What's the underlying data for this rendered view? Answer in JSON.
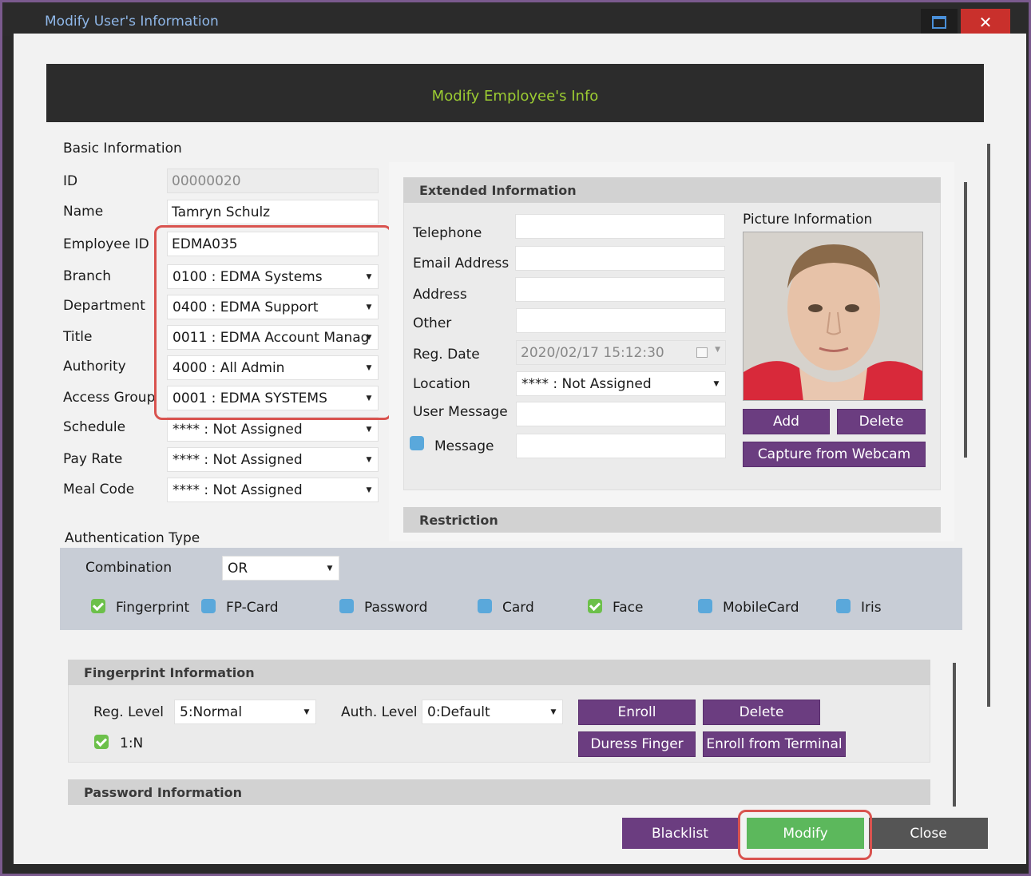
{
  "window": {
    "title": "Modify User's Information",
    "maximize_icon": "maximize-icon",
    "close_icon": "close-icon",
    "close_glyph": "✕"
  },
  "header": {
    "title": "Modify Employee's Info"
  },
  "basic": {
    "heading": "Basic Information",
    "id_label": "ID",
    "id_value": "00000020",
    "name_label": "Name",
    "name_value": "Tamryn Schulz",
    "employee_id_label": "Employee ID",
    "employee_id_value": "EDMA035",
    "branch_label": "Branch",
    "branch_value": "0100 : EDMA Systems",
    "department_label": "Department",
    "department_value": "0400 : EDMA Support",
    "title_label": "Title",
    "title_value": "0011 : EDMA Account Manag",
    "authority_label": "Authority",
    "authority_value": "4000 : All Admin",
    "access_group_label": "Access Group",
    "access_group_value": "0001 : EDMA SYSTEMS",
    "schedule_label": "Schedule",
    "schedule_value": "**** : Not Assigned",
    "pay_rate_label": "Pay Rate",
    "pay_rate_value": "**** : Not Assigned",
    "meal_code_label": "Meal Code",
    "meal_code_value": "**** : Not Assigned"
  },
  "extended": {
    "heading": "Extended Information",
    "telephone_label": "Telephone",
    "telephone_value": "",
    "email_label": "Email Address",
    "email_value": "",
    "address_label": "Address",
    "address_value": "",
    "other_label": "Other",
    "other_value": "",
    "reg_date_label": "Reg. Date",
    "reg_date_value": "2020/02/17 15:12:30",
    "location_label": "Location",
    "location_value": "**** : Not Assigned",
    "user_message_label": "User Message",
    "user_message_value": "",
    "message_label": "Message",
    "message_value": "",
    "picture_label": "Picture Information",
    "add_label": "Add",
    "delete_label": "Delete",
    "webcam_label": "Capture from Webcam"
  },
  "restriction": {
    "heading": "Restriction"
  },
  "auth": {
    "heading": "Authentication Type",
    "combination_label": "Combination",
    "combination_value": "OR",
    "options": [
      {
        "label": "Fingerprint",
        "checked": true
      },
      {
        "label": "FP-Card",
        "checked": false
      },
      {
        "label": "Password",
        "checked": false
      },
      {
        "label": "Card",
        "checked": false
      },
      {
        "label": "Face",
        "checked": true
      },
      {
        "label": "MobileCard",
        "checked": false
      },
      {
        "label": "Iris",
        "checked": false
      }
    ]
  },
  "fingerprint": {
    "heading": "Fingerprint Information",
    "reg_level_label": "Reg. Level",
    "reg_level_value": "5:Normal",
    "auth_level_label": "Auth. Level",
    "auth_level_value": "0:Default",
    "one_n_label": "1:N",
    "one_n_checked": true,
    "enroll_label": "Enroll",
    "delete_label": "Delete",
    "duress_label": "Duress Finger",
    "enroll_terminal_label": "Enroll from Terminal"
  },
  "password": {
    "heading": "Password Information"
  },
  "footer": {
    "blacklist_label": "Blacklist",
    "modify_label": "Modify",
    "close_label": "Close"
  },
  "colors": {
    "accent_purple": "#6b3d80",
    "modify_green": "#5cb85c",
    "highlight_red": "#d9534f",
    "header_green": "#9ccc32"
  }
}
